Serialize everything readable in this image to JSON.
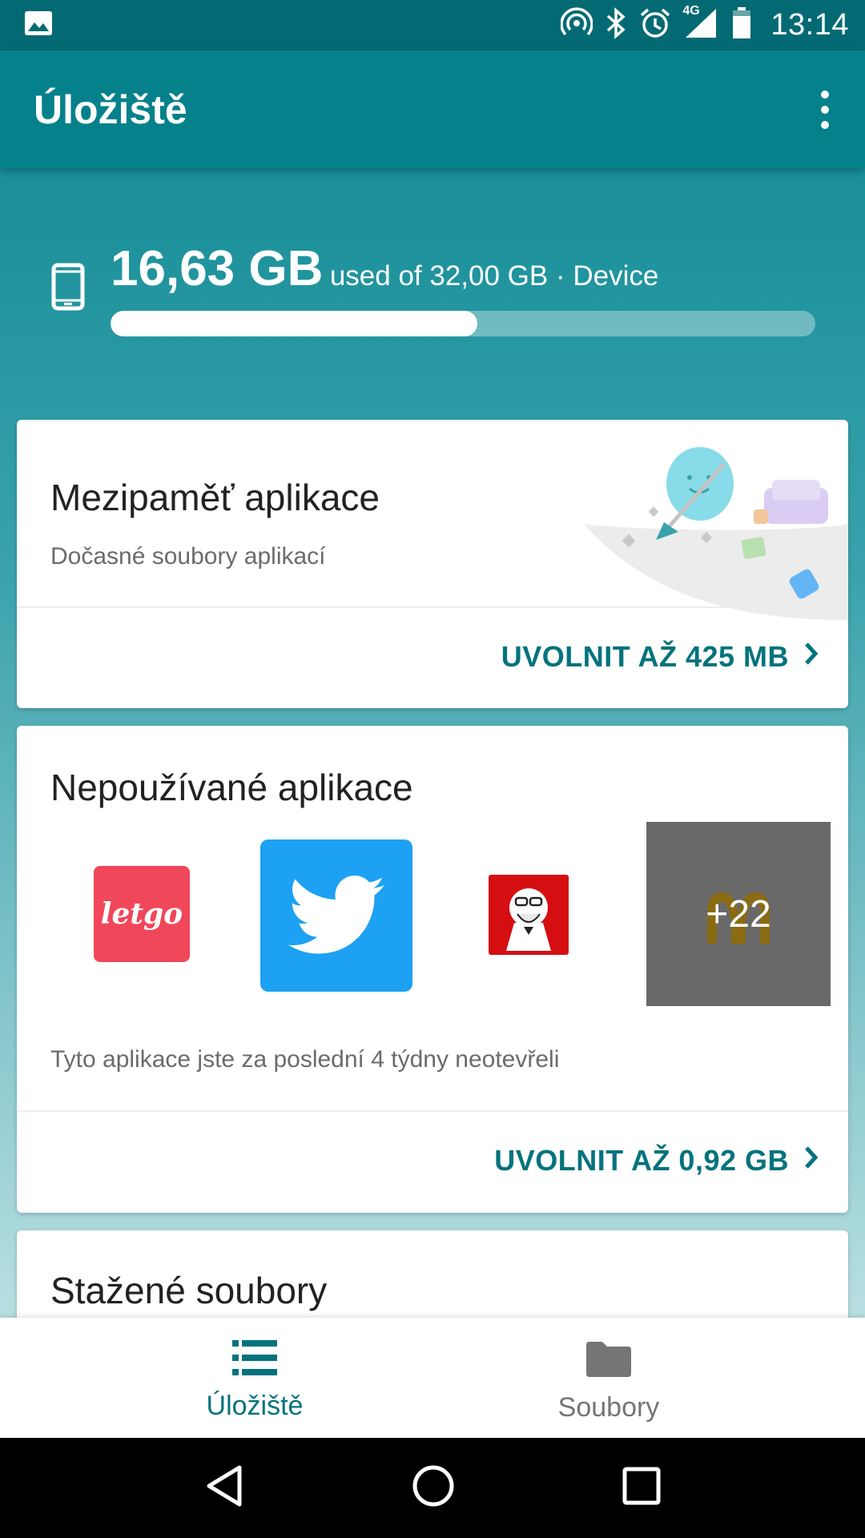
{
  "status_bar": {
    "time": "13:14",
    "network": "4G",
    "icons": [
      "image-icon",
      "hotspot-icon",
      "bluetooth-icon",
      "alarm-icon",
      "signal-icon",
      "battery-icon"
    ]
  },
  "app_bar": {
    "title": "Úložiště",
    "menu_icon": "more-vert-icon"
  },
  "storage": {
    "used": "16,63 GB",
    "details": "used of 32,00 GB · Device",
    "used_fraction": 0.52
  },
  "cards": {
    "cache": {
      "title": "Mezipaměť aplikace",
      "subtitle": "Dočasné soubory aplikací",
      "action": "UVOLNIT AŽ 425 MB"
    },
    "unused_apps": {
      "title": "Nepoužívané aplikace",
      "apps": [
        {
          "name": "letgo",
          "label": "letgo",
          "color": "#f0475a"
        },
        {
          "name": "twitter",
          "color": "#1da1f2"
        },
        {
          "name": "kfc",
          "color": "#d50e12"
        },
        {
          "name": "mcdonalds",
          "color": "#8a6b12"
        }
      ],
      "more_count": "+22",
      "description": "Tyto aplikace jste za poslední 4 týdny neotevřeli",
      "action": "UVOLNIT AŽ 0,92 GB"
    },
    "downloads": {
      "title": "Stažené soubory"
    }
  },
  "bottom_nav": {
    "items": [
      {
        "label": "Úložiště",
        "icon": "storage-icon",
        "active": true
      },
      {
        "label": "Soubory",
        "icon": "folder-icon",
        "active": false
      }
    ]
  },
  "colors": {
    "accent": "#03737d",
    "toolbar": "#05818b",
    "status_bar": "#036a74",
    "inactive": "#757575"
  }
}
